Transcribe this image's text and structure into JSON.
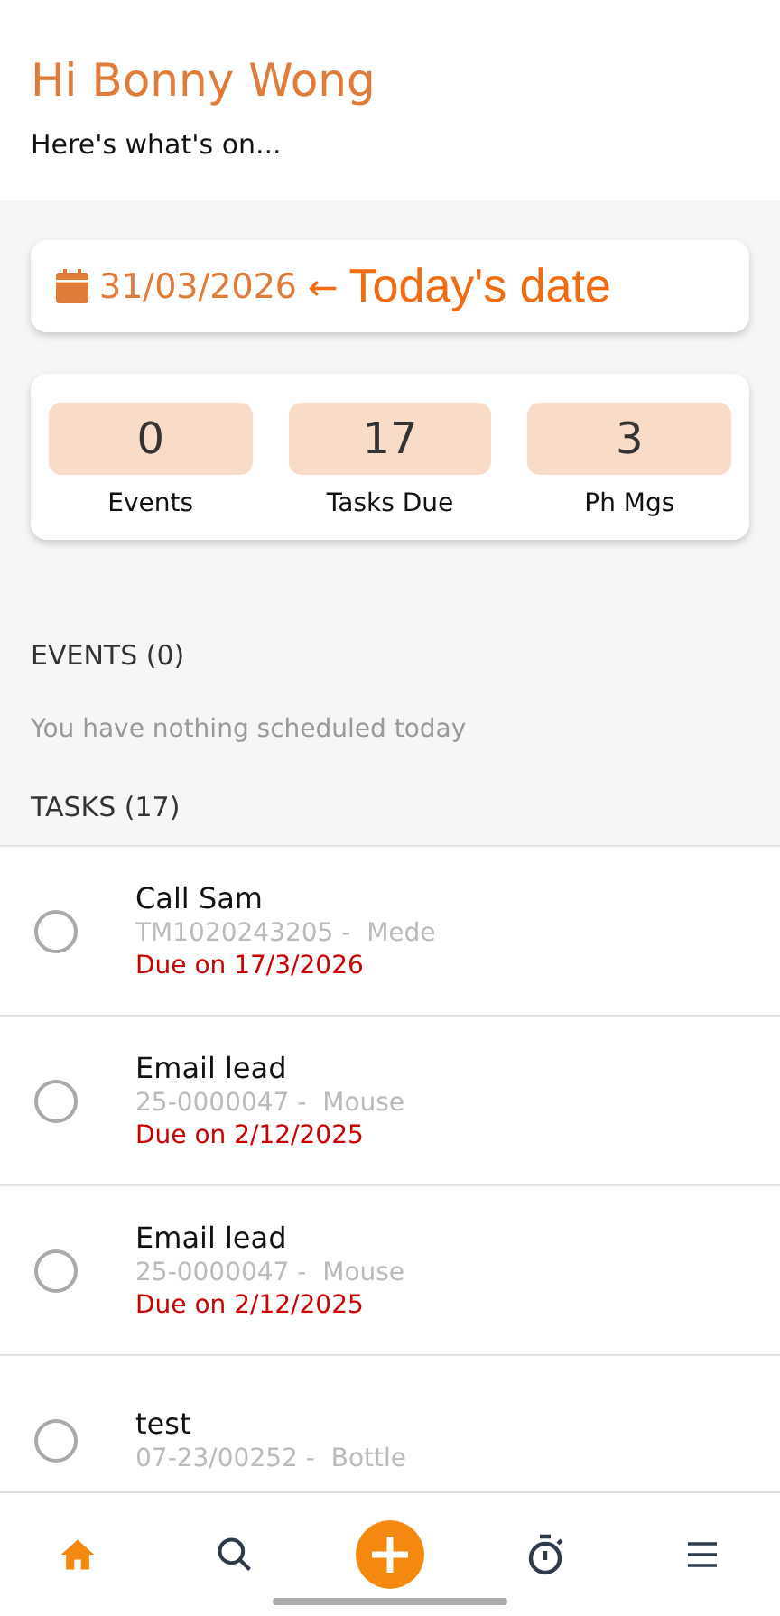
{
  "header": {
    "greeting": "Hi Bonny Wong",
    "subtitle": "Here's what's on..."
  },
  "date_card": {
    "date": "31/03/2026",
    "annotation_arrow": "←",
    "annotation": "Today's date"
  },
  "stats": [
    {
      "value": "0",
      "label": "Events"
    },
    {
      "value": "17",
      "label": "Tasks Due"
    },
    {
      "value": "3",
      "label": "Ph Mgs"
    }
  ],
  "events": {
    "heading": "EVENTS (0)",
    "empty_message": "You have nothing scheduled today"
  },
  "tasks": {
    "heading": "TASKS (17)",
    "items": [
      {
        "title": "Call Sam",
        "reference": "TM1020243205 -  Mede",
        "due": "Due on 17/3/2026",
        "checked": false
      },
      {
        "title": "Email lead",
        "reference": "25-0000047 -  Mouse",
        "due": "Due on 2/12/2025",
        "checked": false
      },
      {
        "title": "Email lead",
        "reference": "25-0000047 -  Mouse",
        "due": "Due on 2/12/2025",
        "checked": false
      },
      {
        "title": "test",
        "reference": "07-23/00252 -  Bottle",
        "checked": false
      }
    ]
  },
  "bottom_nav": [
    {
      "kind": "home",
      "selected": true
    },
    {
      "kind": "search",
      "selected": false
    },
    {
      "kind": "add",
      "selected": false
    },
    {
      "kind": "timer",
      "selected": false
    },
    {
      "kind": "menu",
      "selected": false
    }
  ]
}
